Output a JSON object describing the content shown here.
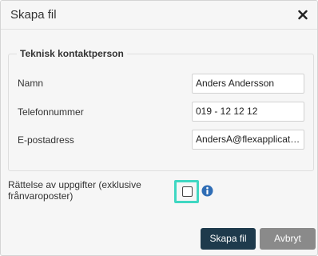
{
  "dialog": {
    "title": "Skapa fil",
    "close_icon": "close-icon"
  },
  "contact_section": {
    "legend": "Teknisk kontaktperson",
    "fields": [
      {
        "label": "Namn",
        "value": "Anders Andersson"
      },
      {
        "label": "Telefonnummer",
        "value": "019 - 12 12 12"
      },
      {
        "label": "E-postadress",
        "value": "AndersA@flexapplications.se"
      }
    ]
  },
  "correction": {
    "label": "Rättelse av uppgifter (exklusive frånvaroposter)",
    "checked": false,
    "highlight_color": "#3fd7c2",
    "info_icon": "info-icon"
  },
  "buttons": {
    "create": "Skapa fil",
    "cancel": "Avbryt"
  },
  "colors": {
    "primary_button": "#1e3a4c",
    "secondary_button": "#8a8a8a",
    "info_icon": "#2f6db5"
  }
}
